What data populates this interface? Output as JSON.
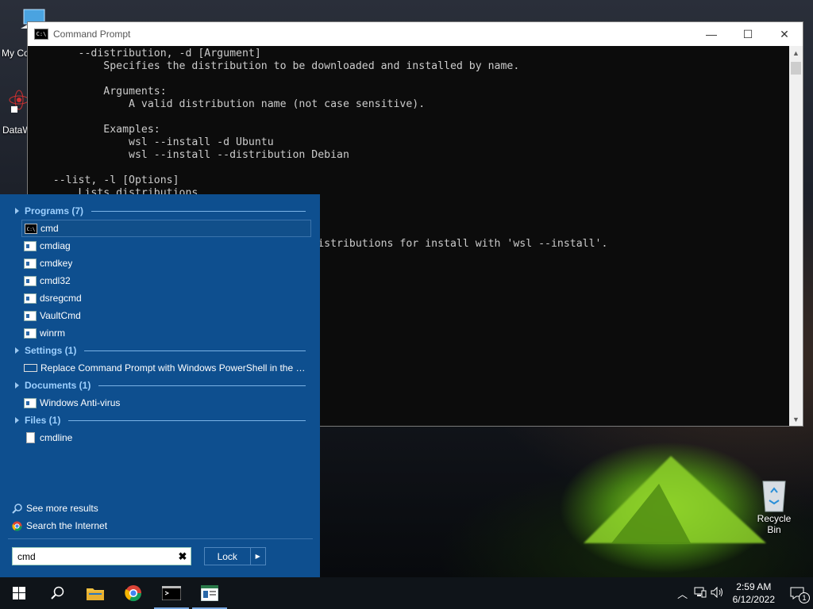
{
  "desktop": {
    "icons": [
      {
        "label": "My Co",
        "icon": "computer-icon"
      },
      {
        "label": "DataW",
        "icon": "atom-app-icon"
      },
      {
        "label": "Recycle Bin",
        "icon": "recycle-bin-icon"
      }
    ]
  },
  "cmd_window": {
    "title": "Command Prompt",
    "minimize": "—",
    "maximize": "☐",
    "close": "✕",
    "lines": [
      "        --distribution, -d [Argument]",
      "            Specifies the distribution to be downloaded and installed by name.",
      "",
      "            Arguments:",
      "                A valid distribution name (not case sensitive).",
      "",
      "            Examples:",
      "                wsl --install -d Ubuntu",
      "                wsl --install --distribution Debian",
      "",
      "    --list, -l [Options]",
      "        Lists distributions.",
      "",
      "",
      "",
      "                                              istributions for install with 'wsl --install'."
    ]
  },
  "start_search": {
    "sections": [
      {
        "title": "Programs (7)",
        "items": [
          {
            "label": "cmd",
            "icon": "cmd"
          },
          {
            "label": "cmdiag",
            "icon": "app"
          },
          {
            "label": "cmdkey",
            "icon": "app"
          },
          {
            "label": "cmdl32",
            "icon": "app"
          },
          {
            "label": "dsregcmd",
            "icon": "app"
          },
          {
            "label": "VaultCmd",
            "icon": "app"
          },
          {
            "label": "winrm",
            "icon": "app"
          }
        ]
      },
      {
        "title": "Settings (1)",
        "items": [
          {
            "label": "Replace Command Prompt with Windows PowerShell in the W...",
            "icon": "setting"
          }
        ]
      },
      {
        "title": "Documents (1)",
        "items": [
          {
            "label": "Windows Anti-virus",
            "icon": "app"
          }
        ]
      },
      {
        "title": "Files (1)",
        "items": [
          {
            "label": "cmdline",
            "icon": "doc"
          }
        ]
      }
    ],
    "see_more": "See more results",
    "search_internet": "Search the Internet",
    "query": "cmd",
    "clear": "✖",
    "lock_label": "Lock",
    "lock_arrow": "▶"
  },
  "taskbar": {
    "time": "2:59 AM",
    "date": "6/12/2022",
    "notification_count": "1"
  }
}
